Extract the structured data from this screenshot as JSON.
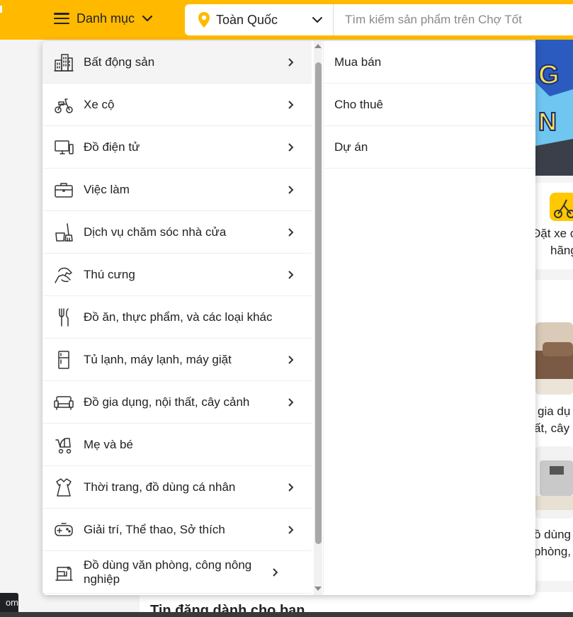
{
  "header": {
    "category_label": "Danh mục",
    "region_label": "Toàn Quốc",
    "search_placeholder": "Tìm kiếm sản phẩm trên Chợ Tốt"
  },
  "menu": {
    "items": [
      {
        "label": "Bất động sản",
        "icon": "building-icon",
        "has_sub": true,
        "active": true
      },
      {
        "label": "Xe cộ",
        "icon": "scooter-icon",
        "has_sub": true
      },
      {
        "label": "Đồ điện tử",
        "icon": "computer-icon",
        "has_sub": true
      },
      {
        "label": "Việc làm",
        "icon": "briefcase-icon",
        "has_sub": true
      },
      {
        "label": "Dịch vụ chăm sóc nhà cửa",
        "icon": "broom-bucket-icon",
        "has_sub": true
      },
      {
        "label": "Thú cưng",
        "icon": "pet-hand-icon",
        "has_sub": true
      },
      {
        "label": "Đồ ăn, thực phẩm, và các loại khác",
        "icon": "fork-knife-icon",
        "has_sub": false
      },
      {
        "label": "Tủ lạnh, máy lạnh, máy giặt",
        "icon": "fridge-icon",
        "has_sub": true
      },
      {
        "label": "Đồ gia dụng, nội thất, cây cảnh",
        "icon": "sofa-icon",
        "has_sub": true
      },
      {
        "label": "Mẹ và bé",
        "icon": "stroller-icon",
        "has_sub": false
      },
      {
        "label": "Thời trang, đồ dùng cá nhân",
        "icon": "dress-icon",
        "has_sub": true
      },
      {
        "label": "Giải trí, Thể thao, Sở thích",
        "icon": "gamepad-icon",
        "has_sub": true
      },
      {
        "label": "Đồ dùng văn phòng, công nông nghiệp",
        "icon": "sewing-machine-icon",
        "has_sub": true
      }
    ],
    "sub_items": [
      "Mua bán",
      "Cho thuê",
      "Dự án"
    ]
  },
  "background": {
    "shortcut_label_1": "Đặt xe c",
    "shortcut_label_2": "hãng",
    "furniture_label_1": "gia dụ",
    "furniture_label_2": "ất, cây",
    "office_label_1": "ồ dùng",
    "office_label_2": "phòng, c",
    "section_heading": "Tin đăng dành cho bạn",
    "url_tip": "om"
  },
  "colors": {
    "brand_yellow": "#ffba00",
    "pin_yellow": "#ffba00"
  }
}
